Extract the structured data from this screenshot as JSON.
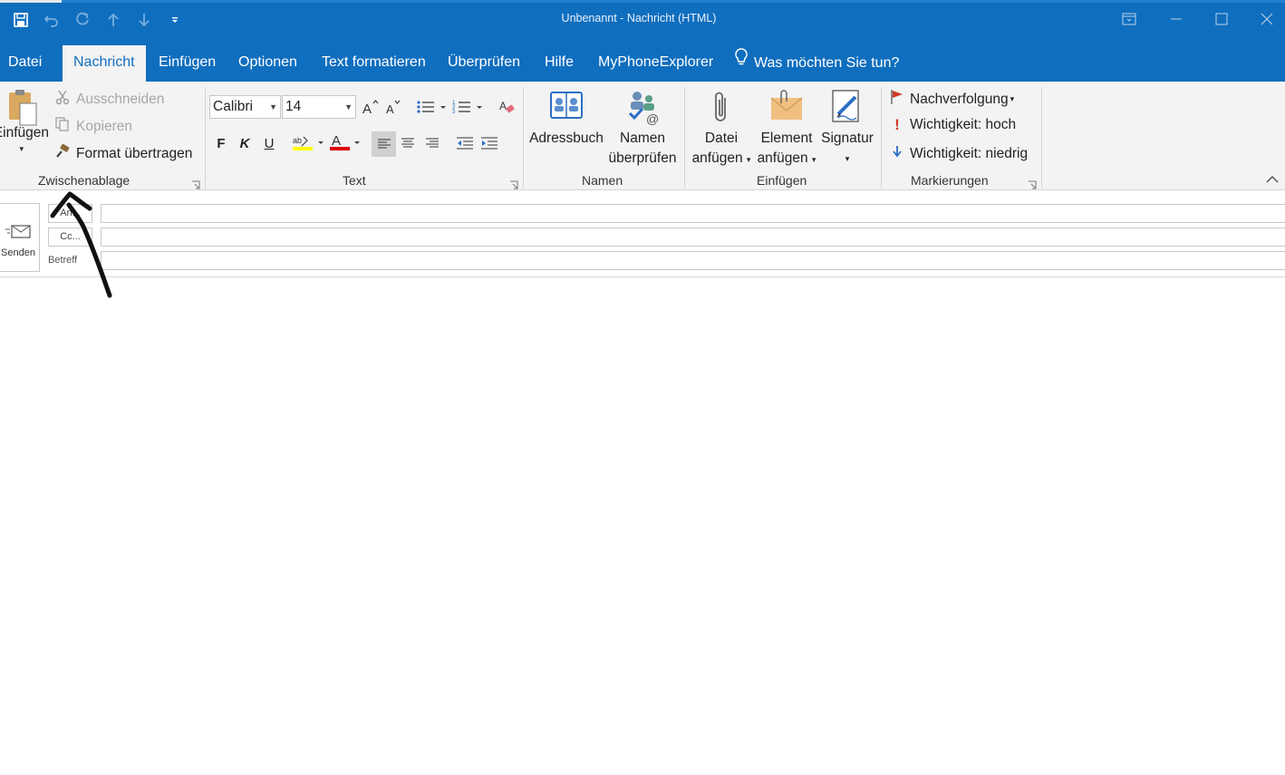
{
  "window": {
    "title": "Unbenannt  -  Nachricht (HTML)"
  },
  "quick_access": [
    "save-icon",
    "undo-icon",
    "redo-icon",
    "up-arrow-icon",
    "down-arrow-icon",
    "customize-icon"
  ],
  "tabs": [
    {
      "label": "Datei",
      "active": false
    },
    {
      "label": "Nachricht",
      "active": true
    },
    {
      "label": "Einfügen",
      "active": false
    },
    {
      "label": "Optionen",
      "active": false
    },
    {
      "label": "Text formatieren",
      "active": false
    },
    {
      "label": "Überprüfen",
      "active": false
    },
    {
      "label": "Hilfe",
      "active": false
    },
    {
      "label": "MyPhoneExplorer",
      "active": false
    }
  ],
  "tellme": {
    "label": "Was möchten Sie tun?"
  },
  "ribbon": {
    "clipboard": {
      "group_label": "Zwischenablage",
      "paste_label": "Einfügen",
      "cut_label": "Ausschneiden",
      "copy_label": "Kopieren",
      "format_painter_label": "Format übertragen"
    },
    "text": {
      "group_label": "Text",
      "font_value": "Calibri",
      "size_value": "14",
      "bold_label": "F",
      "italic_label": "K",
      "underline_label": "U"
    },
    "names": {
      "group_label": "Namen",
      "address_book_label": "Adressbuch",
      "check_names_line1": "Namen",
      "check_names_line2": "überprüfen"
    },
    "include": {
      "group_label": "Einfügen",
      "attach_file_line1": "Datei",
      "attach_file_line2": "anfügen",
      "attach_item_line1": "Element",
      "attach_item_line2": "anfügen",
      "signature_label": "Signatur"
    },
    "tags": {
      "group_label": "Markierungen",
      "follow_up_label": "Nachverfolgung",
      "high_importance_label": "Wichtigkeit: hoch",
      "low_importance_label": "Wichtigkeit: niedrig"
    }
  },
  "compose": {
    "send_label": "Senden",
    "to_label": "An...",
    "cc_label": "Cc...",
    "subject_label": "Betreff",
    "to_value": "",
    "cc_value": "",
    "subject_value": ""
  },
  "colors": {
    "accent": "#106ebe",
    "ribbon_bg": "#f3f3f3",
    "highlight": "#ffff00",
    "font_color": "#e00000"
  }
}
